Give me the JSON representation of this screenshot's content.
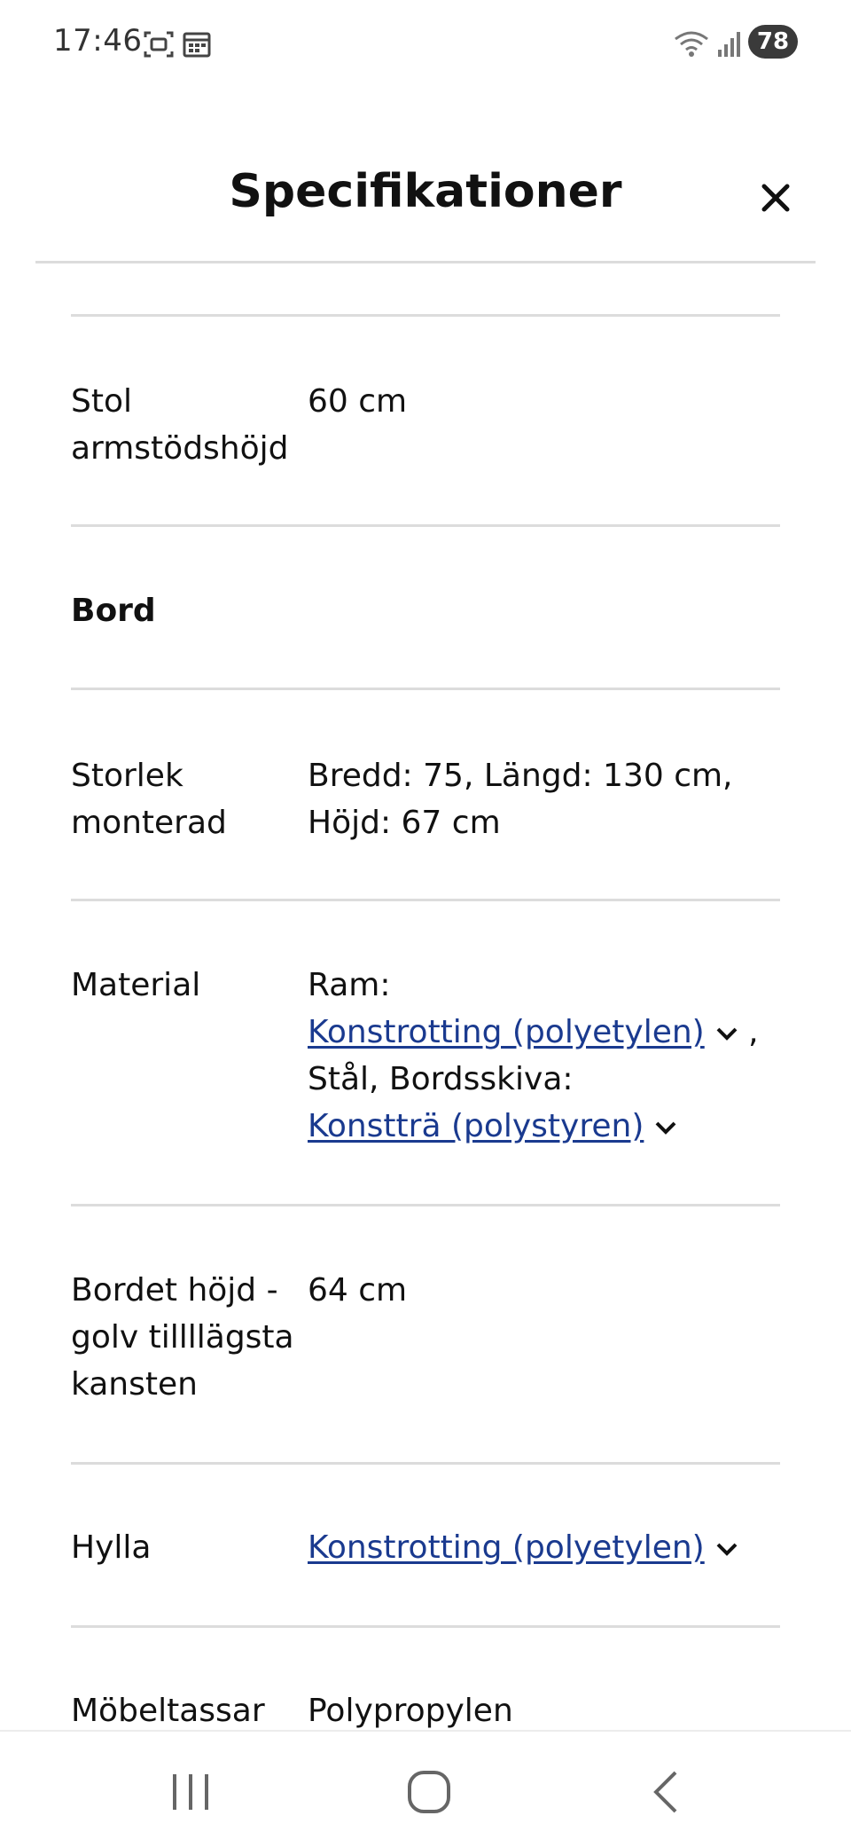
{
  "status_bar": {
    "time": "17:46",
    "battery": "78",
    "icons": [
      "screenshot-icon",
      "calendar-icon",
      "wifi-icon",
      "signal-icon"
    ]
  },
  "header": {
    "title": "Specifikationer",
    "close_icon": "close-icon"
  },
  "specs": {
    "chair_armrest": {
      "label_line1": "Stol",
      "label_line2": "armstödshöjd",
      "value": "60 cm"
    },
    "table_section": "Bord",
    "size": {
      "label_line1": "Storlek",
      "label_line2": "monterad",
      "value_line1": "Bredd: 75, Längd: 130 cm,",
      "value_line2": "Höjd: 67 cm"
    },
    "material": {
      "label": "Material",
      "ram_label": "Ram:",
      "link1": "Konstrotting (polyetylen)",
      "comma": ",",
      "steel_line": "Stål, Bordsskiva:",
      "link2": "Konstträ (polystyren)"
    },
    "table_height": {
      "label_line1": "Bordet höjd -",
      "label_line2": "golv tillllägsta",
      "label_line3": "kansten",
      "value": "64 cm"
    },
    "shelf": {
      "label": "Hylla",
      "link": "Konstrotting (polyetylen)"
    },
    "feet": {
      "label": "Möbeltassar",
      "value": "Polypropylen"
    }
  },
  "nav_bar": {
    "icons": [
      "recent-apps-icon",
      "home-icon",
      "back-icon"
    ]
  },
  "colors": {
    "link": "#1a3a8f",
    "divider": "#dcdcdc",
    "text": "#111111"
  }
}
